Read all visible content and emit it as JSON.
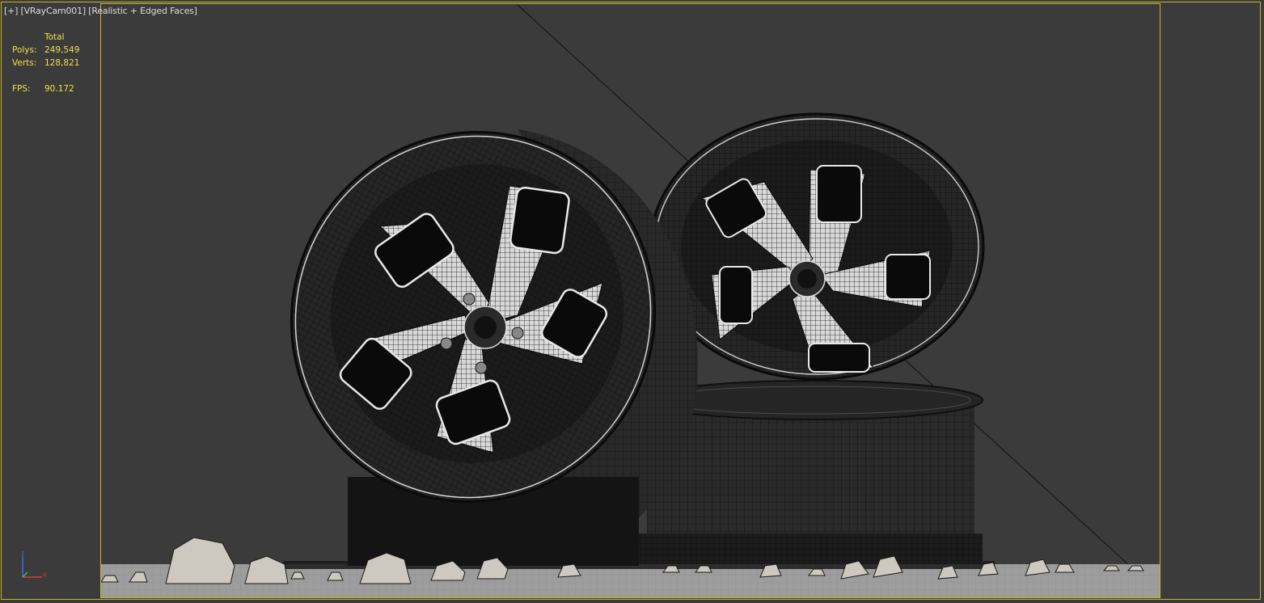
{
  "viewport": {
    "label": {
      "menu": "[+]",
      "camera": "[VRayCam001]",
      "shading": "[Realistic + Edged Faces]"
    },
    "stats": {
      "header": "Total",
      "polys_label": "Polys:",
      "polys_value": "249,549",
      "verts_label": "Verts:",
      "verts_value": "128,821",
      "fps_label": "FPS:",
      "fps_value": "90.172"
    },
    "axis": {
      "z": "z",
      "x": "x"
    }
  },
  "colors": {
    "background": "#3b3b3b",
    "frame": "#c8b72a",
    "stats_text": "#f0e04a",
    "label_text": "#dcdcdc",
    "ground": "#9e9e9e",
    "axis_x": "#e03a3a",
    "axis_y": "#39c439",
    "axis_z": "#3d6df0"
  },
  "scene": {
    "objects": [
      "front-rim",
      "rear-rim",
      "stacked-tire",
      "ground-plane",
      "rocks"
    ]
  }
}
